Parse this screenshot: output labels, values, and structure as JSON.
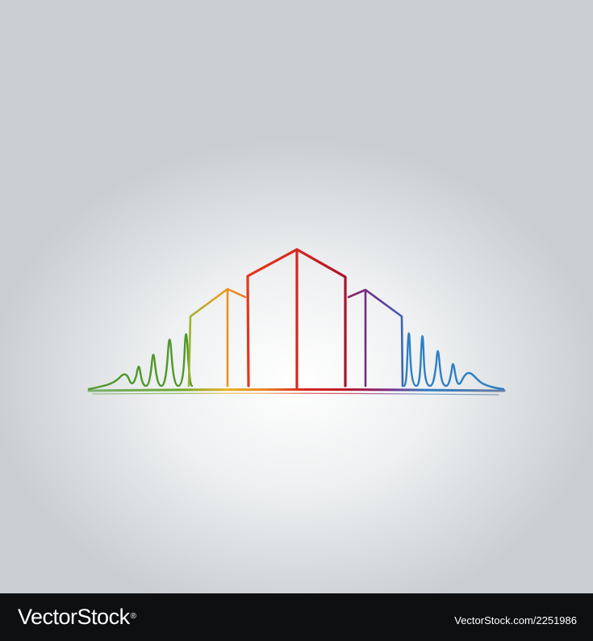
{
  "illustration": {
    "subject": "rainbow-line-city-skyline-logo",
    "colors": {
      "green": "#3f8f2a",
      "yellow": "#e6b21a",
      "orange": "#e9841f",
      "red": "#d9261c",
      "crimson": "#b4152b",
      "purple": "#7a2b86",
      "blue": "#2d7fc4",
      "navy": "#1f3f7a"
    }
  },
  "footer": {
    "brand": "VectorStock",
    "trademark": "®",
    "stock_id": "VectorStock.com/2251986"
  }
}
